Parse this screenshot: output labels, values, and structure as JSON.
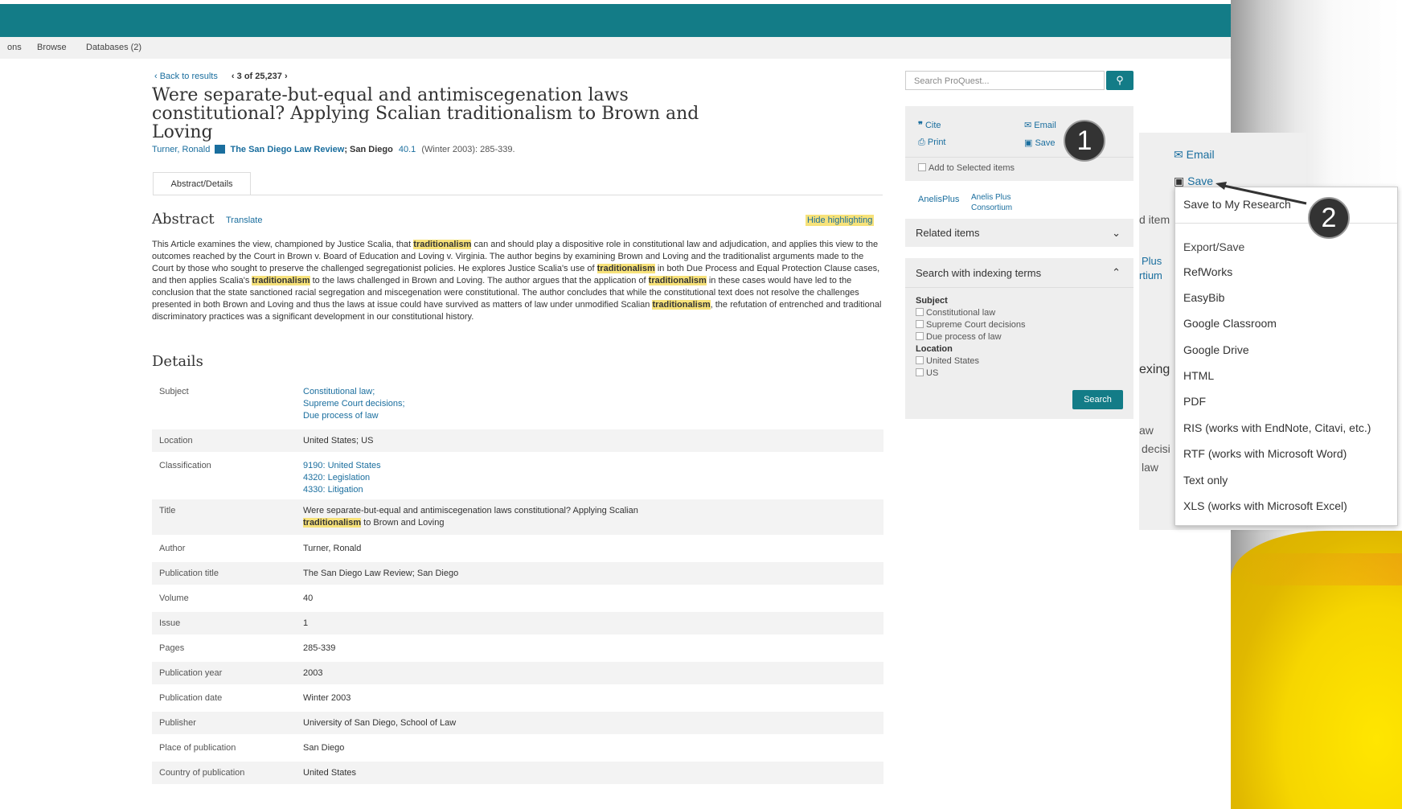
{
  "nav": {
    "items": [
      "ons",
      "Browse",
      "Databases (2)"
    ]
  },
  "result_nav": {
    "back": "‹ Back to results",
    "position": "3 of 25,237"
  },
  "article": {
    "title": "Were separate-but-equal and antimiscegenation laws constitutional? Applying Scalian traditionalism to Brown and Loving",
    "author": "Turner, Ronald",
    "publication": "The San Diego Law Review",
    "place": "; San Diego",
    "volume_issue": "40.1",
    "date_pages": "(Winter 2003): 285-339."
  },
  "tab": "Abstract/Details",
  "abstract": {
    "heading": "Abstract",
    "translate": "Translate",
    "hide_highlighting": "Hide highlighting",
    "highlight_term": "traditionalism",
    "parts": [
      "This Article examines the view, championed by Justice Scalia, that ",
      " can and should play a dispositive role in constitutional law and adjudication, and applies this view to the outcomes reached by the Court in Brown v. Board of Education and Loving v. Virginia. The author begins by examining Brown and Loving and the traditionalist arguments made to the Court by those who sought to preserve the challenged segregationist policies. He explores Justice Scalia's use of ",
      " in both Due Process and Equal Protection Clause cases, and then applies Scalia's ",
      " to the laws challenged in Brown and Loving. The author argues that the application of ",
      " in these cases would have led to the conclusion that the state sanctioned racial segregation and miscegenation were constitutional. The author concludes that while the constitutional text does not resolve the challenges presented in both Brown and Loving and thus the laws at issue could have survived as matters of law under unmodified Scalian ",
      ", the refutation of entrenched and traditional discriminatory practices was a significant development in our constitutional history."
    ]
  },
  "details": {
    "heading": "Details",
    "subject_label": "Subject",
    "subject": [
      "Constitutional law;",
      "Supreme Court decisions;",
      "Due process of law"
    ],
    "location_label": "Location",
    "location": "United States; US",
    "classification_label": "Classification",
    "classification": [
      "9190: United States",
      "4320: Legislation",
      "4330: Litigation"
    ],
    "title_label": "Title",
    "title_prefix": "Were separate-but-equal and antimiscegenation laws constitutional? Applying Scalian",
    "title_suffix": " to Brown and Loving",
    "author_label": "Author",
    "author": "Turner, Ronald",
    "pubtitle_label": "Publication title",
    "pubtitle": "The San Diego Law Review; San Diego",
    "volume_label": "Volume",
    "volume": "40",
    "issue_label": "Issue",
    "issue": "1",
    "pages_label": "Pages",
    "pages": "285-339",
    "pubyear_label": "Publication year",
    "pubyear": "2003",
    "pubdate_label": "Publication date",
    "pubdate": "Winter 2003",
    "publisher_label": "Publisher",
    "publisher": "University of San Diego, School of Law",
    "place_label": "Place of publication",
    "place": "San Diego",
    "country_label": "Country of publication",
    "country": "United States"
  },
  "sidebar": {
    "search_placeholder": "Search ProQuest...",
    "cite": "Cite",
    "print": "Print",
    "email": "Email",
    "save": "Save",
    "add_selected": "Add to Selected items",
    "anelis": "AnelisPlus",
    "anelis_sub1": "Anelis Plus",
    "anelis_sub2": "Consortium",
    "related": "Related items",
    "indexing": "Search with indexing terms",
    "subject_heading": "Subject",
    "subject_terms": [
      "Constitutional law",
      "Supreme Court decisions",
      "Due process of law"
    ],
    "location_heading": "Location",
    "location_terms": [
      "United States",
      "US"
    ],
    "search_button": "Search"
  },
  "zoom": {
    "email": "Email",
    "save": "Save",
    "cut_items": "d item",
    "cut_plus": "Plus",
    "cut_tium": "rtium",
    "cut_exing": "exing",
    "cut_aw": "aw",
    "cut_decisi": "decisi",
    "cut_law": "law"
  },
  "save_menu": [
    "Save to My Research",
    "Export/Save",
    "RefWorks",
    "EasyBib",
    "Google Classroom",
    "Google Drive",
    "HTML",
    "PDF",
    "RIS (works with EndNote, Citavi, etc.)",
    "RTF (works with Microsoft Word)",
    "Text only",
    "XLS (works with Microsoft Excel)"
  ],
  "callouts": [
    "1",
    "2"
  ],
  "colors": {
    "teal": "#137c87",
    "link": "#1a6e9e",
    "highlight": "#f7e27a"
  }
}
